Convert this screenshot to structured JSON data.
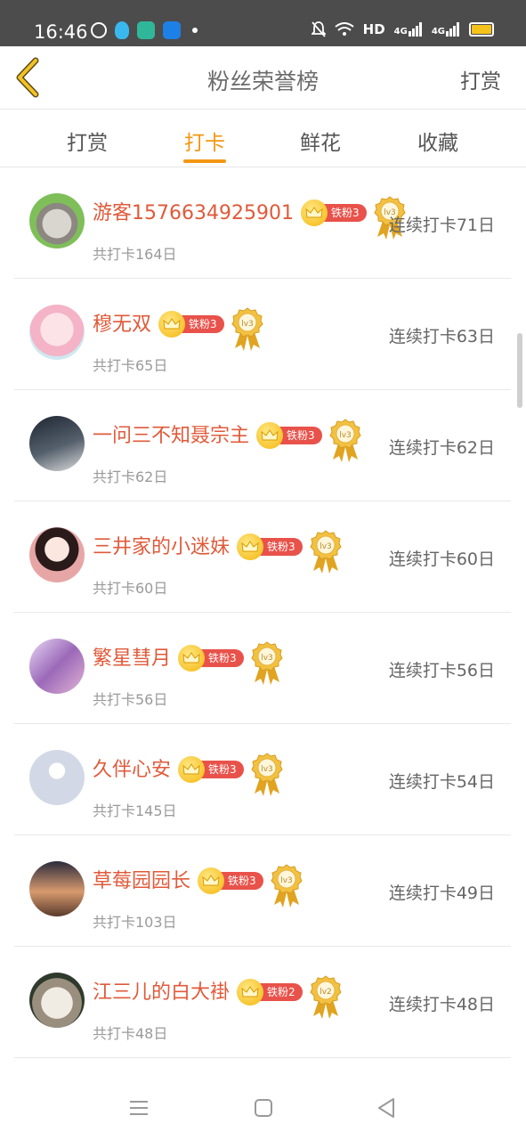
{
  "status_bar": {
    "time": "16:46",
    "network_label": "HD",
    "signal1": "4G",
    "signal2": "4G"
  },
  "header": {
    "back_icon": "chevron-left-icon",
    "title": "粉丝荣誉榜",
    "right_action": "打赏"
  },
  "tabs": [
    {
      "label": "打赏",
      "active": false
    },
    {
      "label": "打卡",
      "active": true
    },
    {
      "label": "鲜花",
      "active": false
    },
    {
      "label": "收藏",
      "active": false
    }
  ],
  "accent_color": "#f39712",
  "name_color": "#e05a3a",
  "rows": [
    {
      "name": "游客1576634925901",
      "fan_label": "铁粉3",
      "level": "lv3",
      "total": "共打卡164日",
      "streak": "连续打卡71日",
      "avatar": "cat"
    },
    {
      "name": "穆无双",
      "fan_label": "铁粉3",
      "level": "lv3",
      "total": "共打卡65日",
      "streak": "连续打卡63日",
      "avatar": "pink-girl"
    },
    {
      "name": "一问三不知聂宗主",
      "fan_label": "铁粉3",
      "level": "lv3",
      "total": "共打卡62日",
      "streak": "连续打卡62日",
      "avatar": "dark-figure"
    },
    {
      "name": "三井家的小迷妹",
      "fan_label": "铁粉3",
      "level": "lv3",
      "total": "共打卡60日",
      "streak": "连续打卡60日",
      "avatar": "anime-girl"
    },
    {
      "name": "繁星彗月",
      "fan_label": "铁粉3",
      "level": "lv3",
      "total": "共打卡56日",
      "streak": "连续打卡56日",
      "avatar": "purple-anime"
    },
    {
      "name": "久伴心安",
      "fan_label": "铁粉3",
      "level": "lv3",
      "total": "共打卡145日",
      "streak": "连续打卡54日",
      "avatar": "default"
    },
    {
      "name": "草莓园园长",
      "fan_label": "铁粉3",
      "level": "lv3",
      "total": "共打卡103日",
      "streak": "连续打卡49日",
      "avatar": "sunset"
    },
    {
      "name": "江三儿的白大褂",
      "fan_label": "铁粉2",
      "level": "lv2",
      "total": "共打卡48日",
      "streak": "连续打卡48日",
      "avatar": "sheep"
    }
  ],
  "nav": [
    "menu-icon",
    "home-square-icon",
    "back-triangle-icon"
  ]
}
